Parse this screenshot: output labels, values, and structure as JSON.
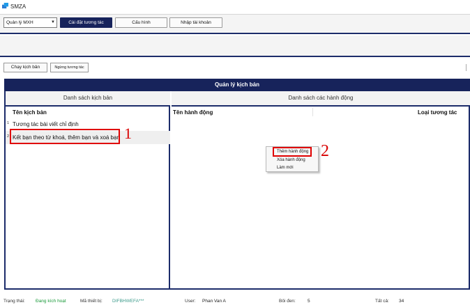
{
  "window": {
    "title": "SMZA"
  },
  "toolbar": {
    "select_value": "Quản lý MXH",
    "btn_tuongtac": "Cài đặt tương tác",
    "btn_cauhinh": "Cấu hình",
    "btn_nhaptk": "Nhập tài khoản"
  },
  "actions": {
    "chay": "Chạy kịch bản",
    "ngung": "Ngừng tương tác"
  },
  "main": {
    "header": "Quản lý kịch bản",
    "left": {
      "heading": "Danh sách kịch bản",
      "column": "Tên kịch bản",
      "rows": [
        {
          "num": "1",
          "name": "Tương tác bài viết chỉ định"
        },
        {
          "num": "2",
          "name": "Kết bạn theo từ khoá, thêm bạn và xoá bạn"
        }
      ]
    },
    "right": {
      "heading": "Danh sách các hành động",
      "col_name": "Tên hành động",
      "col_type": "Loại tương tác"
    }
  },
  "context_menu": {
    "items": [
      "Thêm hành động",
      "Xóa hành động",
      "Làm mới"
    ]
  },
  "markers": {
    "one": "1",
    "two": "2"
  },
  "status": {
    "trangthai_label": "Trạng thái:",
    "trangthai_value": "Đang kích hoạt",
    "device_label": "Mã thiết bị:",
    "device_value": "DIFBHWEFA***",
    "user_label": "User:",
    "user_value": "Phan Van A",
    "boiden_label": "Bôi đen:",
    "boiden_value": "5",
    "tatca_label": "Tất cả:",
    "tatca_value": "34"
  },
  "colors": {
    "navy": "#17235b",
    "highlight": "#e00000",
    "status_green": "#1a9a3a"
  }
}
